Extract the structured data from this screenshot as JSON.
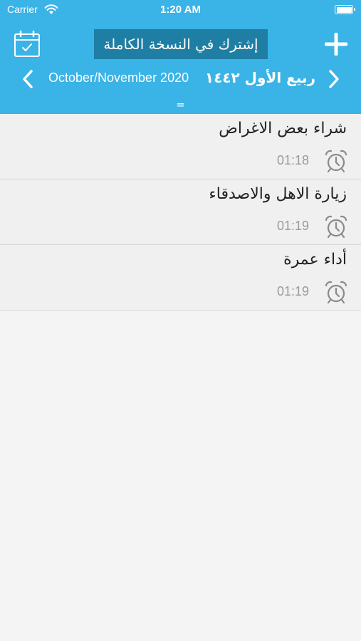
{
  "status_bar": {
    "carrier": "Carrier",
    "time": "1:20 AM"
  },
  "toolbar": {
    "subscribe_label": "إشترك في النسخة الكاملة"
  },
  "month_nav": {
    "gregorian": "October/November 2020",
    "hijri": "ربيع الأول ١٤٤٢"
  },
  "handle": "=",
  "reminders": [
    {
      "title": "شراء بعض الاغراض",
      "time": "01:18"
    },
    {
      "title": "زيارة الاهل والاصدقاء",
      "time": "01:19"
    },
    {
      "title": "أداء عمرة",
      "time": "01:19"
    }
  ],
  "colors": {
    "header": "#3ab3e6",
    "subscribe_bg": "#1f7ea3",
    "background": "#f4f4f4"
  }
}
